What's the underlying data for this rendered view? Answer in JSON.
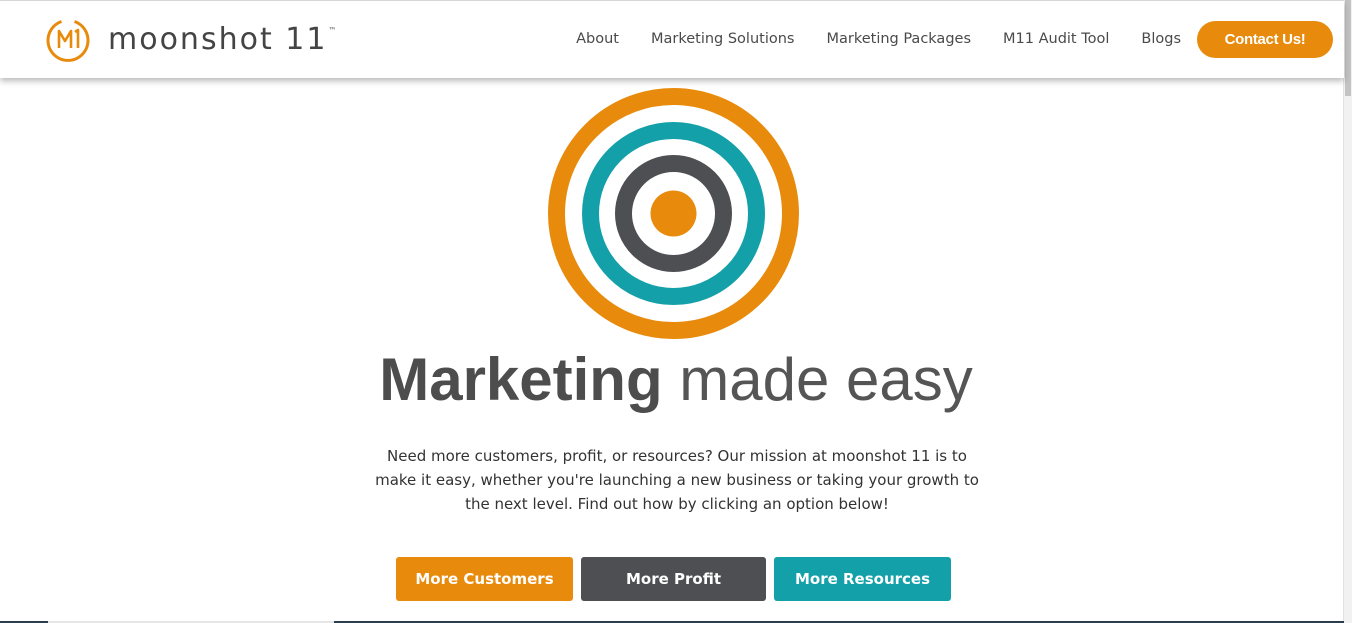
{
  "brand": {
    "name": "moonshot 11",
    "trademark": "™",
    "logo_icon": "m1-circle-logo-icon",
    "colors": {
      "orange": "#e88b0c",
      "teal": "#14a0a9",
      "charcoal": "#4d4f53"
    }
  },
  "nav": {
    "items": [
      {
        "label": "About"
      },
      {
        "label": "Marketing Solutions"
      },
      {
        "label": "Marketing Packages"
      },
      {
        "label": "M11 Audit Tool"
      },
      {
        "label": "Blogs"
      }
    ],
    "cta_label": "Contact Us!"
  },
  "hero": {
    "graphic_icon": "target-icon",
    "headline_bold": "Marketing",
    "headline_light": "made easy",
    "intro": "Need more customers, profit, or resources? Our mission at moonshot 11 is to make it easy, whether you're launching a new business or taking your growth to the next level. Find out how by clicking an option below!",
    "buttons": [
      {
        "label": "More Customers",
        "color": "#e88b0c"
      },
      {
        "label": "More Profit",
        "color": "#4d4f53"
      },
      {
        "label": "More Resources",
        "color": "#14a0a9"
      }
    ]
  }
}
